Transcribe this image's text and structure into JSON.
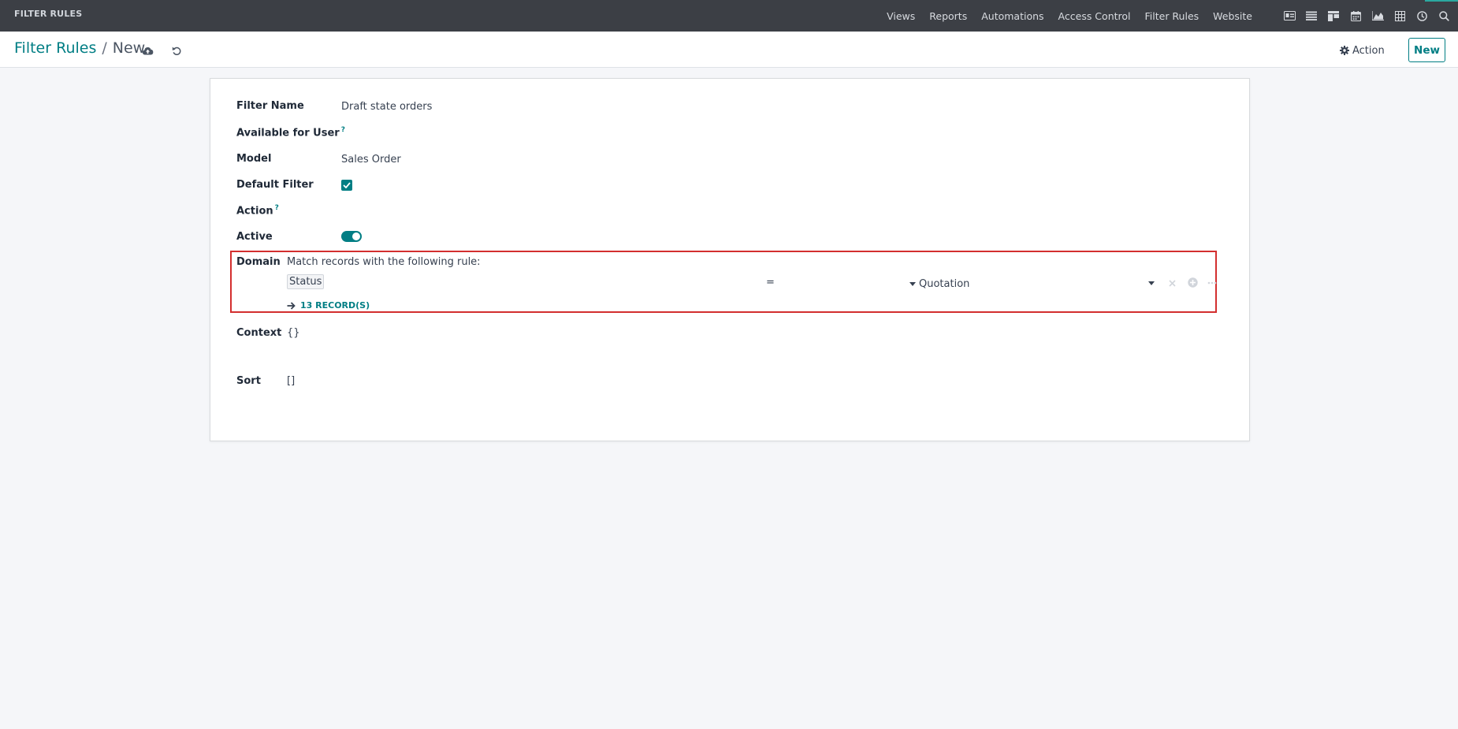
{
  "navbar": {
    "brand": "FILTER RULES",
    "menu": [
      "Views",
      "Reports",
      "Automations",
      "Access Control",
      "Filter Rules",
      "Website"
    ],
    "icons": [
      "form-view-icon",
      "list-view-icon",
      "kanban-view-icon",
      "calendar-view-icon",
      "graph-view-icon",
      "pivot-view-icon",
      "activity-view-icon",
      "search-icon"
    ]
  },
  "breadcrumb": {
    "parent": "Filter Rules",
    "separator": "/",
    "current": "New"
  },
  "actions": {
    "action_label": "Action",
    "new_label": "New"
  },
  "form": {
    "filter_name_label": "Filter Name",
    "filter_name_value": "Draft state orders",
    "available_user_label": "Available for User",
    "help_mark": "?",
    "model_label": "Model",
    "model_value": "Sales Order",
    "default_filter_label": "Default Filter",
    "default_filter_checked": true,
    "action_label": "Action",
    "active_label": "Active",
    "active_on": true,
    "domain_label": "Domain",
    "domain_intro": "Match records with the following rule:",
    "domain_field": "Status",
    "domain_operator": "=",
    "domain_value": "Quotation",
    "records_link": "13 RECORD(S)",
    "context_label": "Context",
    "context_value": "{}",
    "sort_label": "Sort",
    "sort_value": "[]"
  },
  "colors": {
    "brand": "#017e84",
    "navbar": "#3c3f45",
    "highlight": "#d32f2f"
  }
}
